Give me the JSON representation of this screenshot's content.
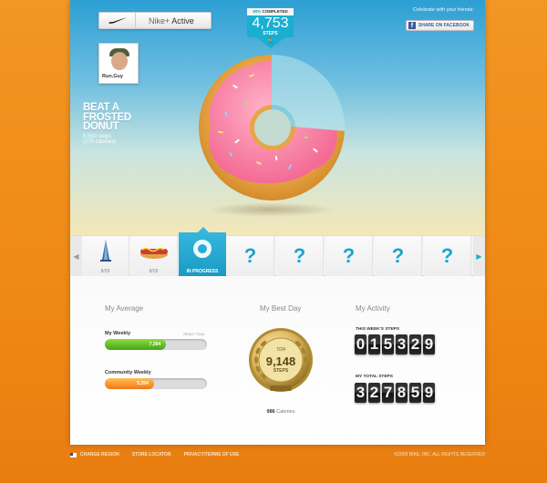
{
  "header": {
    "brand_prefix": "Nike+",
    "brand_name": "Active"
  },
  "profile": {
    "name": "Run.Guy"
  },
  "goal_badge": {
    "percent_label": "80%",
    "completed_label": "COMPLETED",
    "value": "4,753",
    "unit": "STEPS"
  },
  "share": {
    "prompt": "Celebrate with your friends:",
    "button_label": "SHARE ON FACEBOOK"
  },
  "challenge": {
    "title_lines": [
      "BEAT A",
      "FROSTED",
      "DONUT"
    ],
    "steps": "5,500 steps",
    "calories": "(270 calories)",
    "progress": 0.8
  },
  "carousel": {
    "items": [
      {
        "icon": "tower-icon",
        "date": "8/26"
      },
      {
        "icon": "hotdog-icon",
        "date": "8/28"
      },
      {
        "icon": "donut-icon",
        "date": "IN PROGRESS",
        "active": true
      },
      {
        "icon": "question-icon",
        "label": "?"
      },
      {
        "icon": "question-icon",
        "label": "?"
      },
      {
        "icon": "question-icon",
        "label": "?"
      },
      {
        "icon": "question-icon",
        "label": "?"
      },
      {
        "icon": "question-icon",
        "label": "?"
      }
    ]
  },
  "average": {
    "title": "My Average",
    "weekly": {
      "label": "My Weekly",
      "hint": "Steps / Day",
      "value": "7,394",
      "fraction": 0.6
    },
    "community": {
      "label": "Community Weekly",
      "value": "5,394",
      "fraction": 0.48
    }
  },
  "best_day": {
    "title": "My Best Day",
    "date": "7/24",
    "value": "9,148",
    "unit": "STEPS",
    "calories_value": "986",
    "calories_label": "Calories"
  },
  "activity": {
    "title": "My Activity",
    "week_label": "THIS WEEK'S STEPS",
    "week_digits": [
      "0",
      "1",
      "5",
      "3",
      "2",
      "9"
    ],
    "total_label": "MY TOTAL STEPS",
    "total_digits": [
      "3",
      "2",
      "7",
      "8",
      "5",
      "9"
    ]
  },
  "footer": {
    "change_region": "CHANGE REGION",
    "store_locator": "STORE LOCATOR",
    "privacy": "PRIVACY/TERMS OF USE",
    "copyright": "©2009 NIKE, INC. ALL RIGHTS RESERVED"
  },
  "colors": {
    "accent": "#1aaed1",
    "orange": "#f08a16",
    "green": "#5fbf1f"
  }
}
